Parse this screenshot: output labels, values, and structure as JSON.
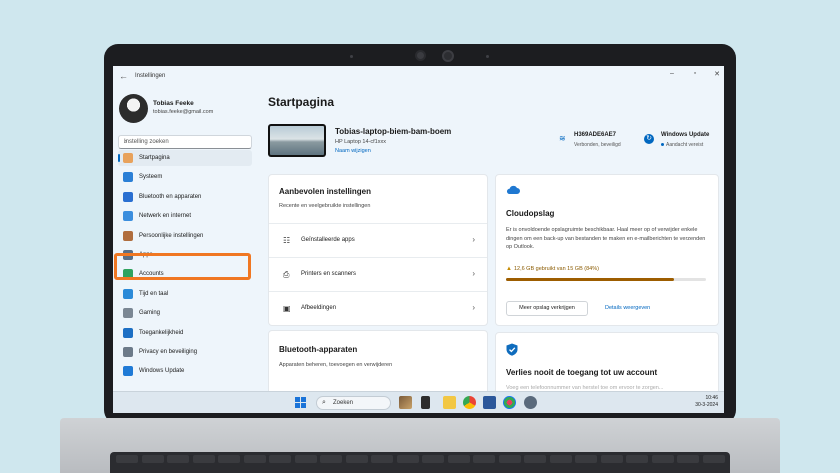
{
  "window": {
    "title": "Instellingen",
    "back_glyph": "←",
    "minimize_glyph": "–",
    "maximize_glyph": "▫",
    "close_glyph": "✕"
  },
  "user": {
    "name": "Tobias Feeke",
    "email": "tobias.feeke@gmail.com"
  },
  "search": {
    "placeholder": "Instelling zoeken",
    "icon_glyph": "⌕"
  },
  "nav": [
    {
      "label": "Startpagina",
      "name": "home",
      "color": "#e8a25c",
      "active": true
    },
    {
      "label": "Systeem",
      "name": "system",
      "color": "#2b7fd6"
    },
    {
      "label": "Bluetooth en apparaten",
      "name": "bluetooth",
      "color": "#2a6fd1"
    },
    {
      "label": "Netwerk en internet",
      "name": "network",
      "color": "#3b8ede"
    },
    {
      "label": "Persoonlijke instellingen",
      "name": "personalization",
      "color": "#b06d3e"
    },
    {
      "label": "Apps",
      "name": "apps",
      "color": "#5a6f86"
    },
    {
      "label": "Accounts",
      "name": "accounts",
      "color": "#2fa35f"
    },
    {
      "label": "Tijd en taal",
      "name": "time-language",
      "color": "#2b8ad8"
    },
    {
      "label": "Gaming",
      "name": "gaming",
      "color": "#7b8794"
    },
    {
      "label": "Toegankelijkheid",
      "name": "accessibility",
      "color": "#1d6fc4"
    },
    {
      "label": "Privacy en beveiliging",
      "name": "privacy",
      "color": "#6c7a89"
    },
    {
      "label": "Windows Update",
      "name": "windows-update",
      "color": "#1f7ad6"
    }
  ],
  "main": {
    "title": "Startpagina",
    "device": {
      "name": "Tobias-laptop-biem-bam-boem",
      "model": "HP Laptop 14-cf1xxx",
      "rename_label": "Naam wijzigen"
    },
    "wifi": {
      "name": "H369ADE6AE7",
      "status": "Verbonden, beveiligd",
      "icon_glyph": "≋"
    },
    "update": {
      "title": "Windows Update",
      "status": "Aandacht vereist",
      "icon_glyph": "↻"
    },
    "recommended": {
      "title": "Aanbevolen instellingen",
      "subtitle": "Recente en veelgebruikte instellingen",
      "rows": [
        {
          "label": "Geïnstalleerde apps",
          "icon_glyph": "☷",
          "chevron": "›"
        },
        {
          "label": "Printers en scanners",
          "icon_glyph": "⎙",
          "chevron": "›"
        },
        {
          "label": "Afbeeldingen",
          "icon_glyph": "▣",
          "chevron": "›"
        }
      ]
    },
    "cloud": {
      "title": "Cloudopslag",
      "description": "Er is onvoldoende opslagruimte beschikbaar. Haal meer op of verwijder enkele dingen om een back-up van bestanden te maken en e-mailberichten te verzenden op Outlook.",
      "warn_glyph": "▲",
      "usage": "12,6 GB gebruikt van 15 GB (84%)",
      "usage_fraction": 0.84,
      "button_more": "Meer opslag verkrijgen",
      "link_details": "Details weergeven"
    },
    "bluetooth": {
      "title": "Bluetooth-apparaten",
      "subtitle": "Apparaten beheren, toevoegen en verwijderen"
    },
    "account": {
      "title": "Verlies nooit de toegang tot uw account",
      "subtitle": "Voeg een telefoonnummer van herstel toe om ervoor te zorgen..."
    }
  },
  "taskbar": {
    "search_label": "Zoeken",
    "search_glyph": "⌕",
    "time": "10:46",
    "date": "30-3-2024"
  },
  "colors": {
    "accent": "#0067c0",
    "highlight": "#f07722",
    "storage_bar": "#9d5d00"
  }
}
